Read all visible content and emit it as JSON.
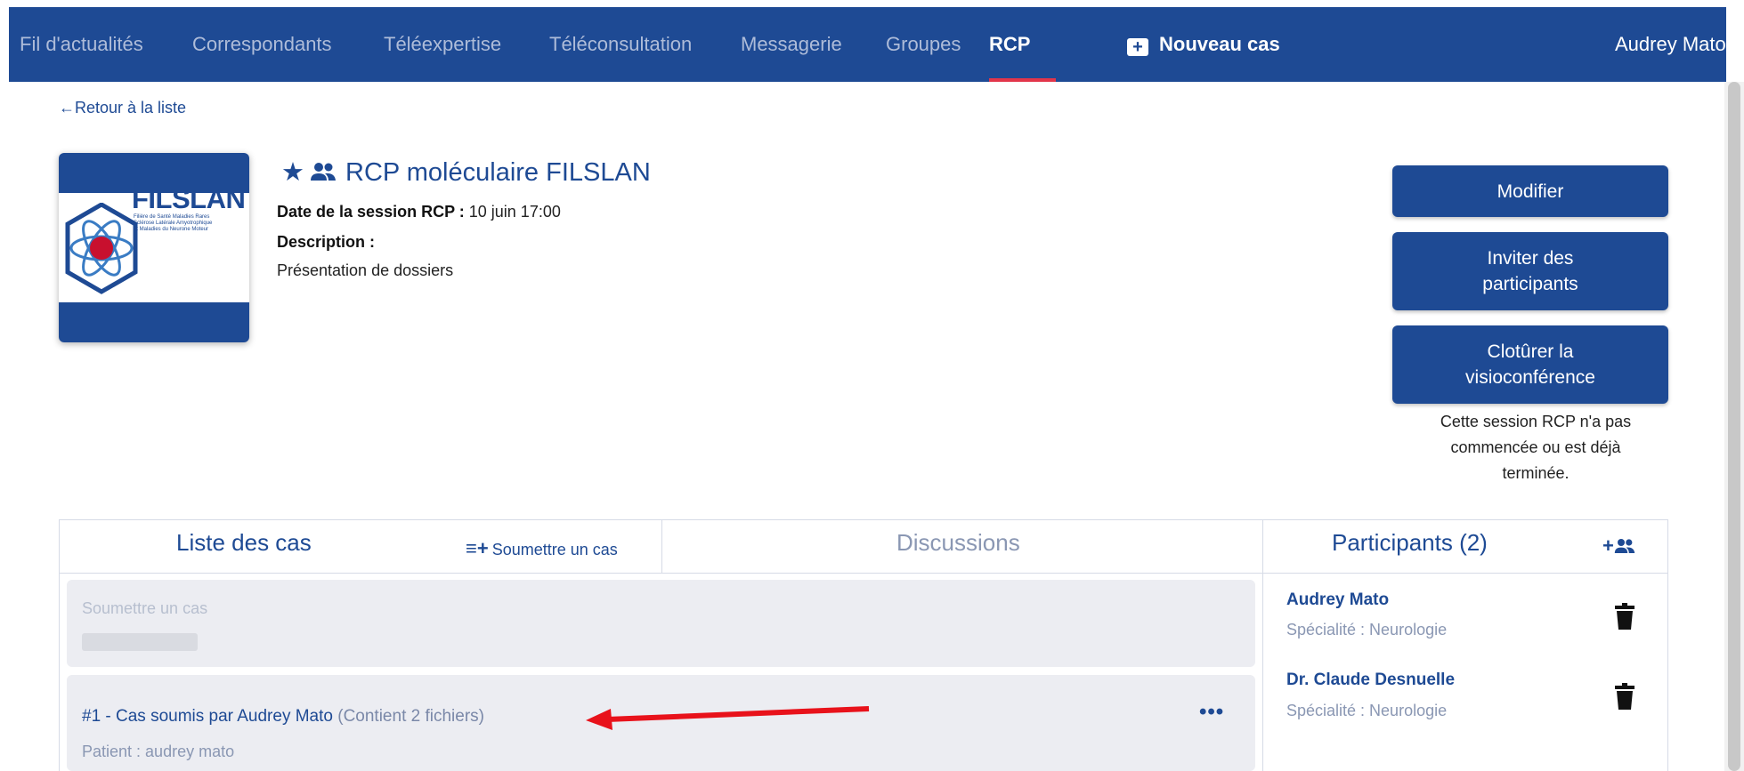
{
  "nav": {
    "items": [
      "Fil d'actualités",
      "Correspondants",
      "Téléexpertise",
      "Téléconsultation",
      "Messagerie",
      "Groupes",
      "RCP"
    ],
    "active": "RCP",
    "new_case": "Nouveau cas",
    "user": "Audrey Mato"
  },
  "back_link": "←Retour à la liste",
  "logo": {
    "word": "FILSLAN",
    "small_1": "Filière de Santé Maladies Rares",
    "small_2": "Sclérose Latérale Amyotrophique",
    "small_3": "et Maladies du Neurone Moteur"
  },
  "session": {
    "title": "RCP moléculaire FILSLAN",
    "date_label": "Date de la session RCP :",
    "date_value": "10 juin 17:00",
    "description_label": "Description :",
    "description_value": "Présentation de dossiers"
  },
  "actions": {
    "modify": "Modifier",
    "invite_line1": "Inviter des",
    "invite_line2": "participants",
    "close_line1": "Clotûrer la",
    "close_line2": "visioconférence",
    "note_line1": "Cette session RCP n'a pas",
    "note_line2": "commencée ou est déjà",
    "note_line3": "terminée."
  },
  "tabs": {
    "cases": "Liste des cas",
    "submit_case": "Soumettre un cas",
    "discussions": "Discussions",
    "participants": "Participants (2)"
  },
  "cases": {
    "placeholder": "Soumettre un cas",
    "items": [
      {
        "title": "#1 - Cas soumis par Audrey Mato",
        "files": "(Contient 2 fichiers)",
        "patient": "Patient : audrey mato"
      }
    ]
  },
  "participants": [
    {
      "name": "Audrey Mato",
      "specialty": "Spécialité : Neurologie"
    },
    {
      "name": "Dr. Claude Desnuelle",
      "specialty": "Spécialité : Neurologie"
    }
  ],
  "colors": {
    "nav_bg": "#1e4a94",
    "accent_underline": "#e2354a",
    "annotation_arrow": "#e8121b"
  }
}
